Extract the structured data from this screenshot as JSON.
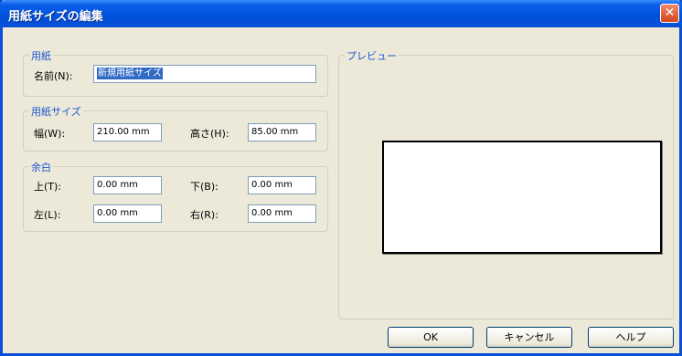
{
  "window": {
    "title": "用紙サイズの編集",
    "close_glyph": "✕"
  },
  "paper": {
    "legend": "用紙",
    "name_label": "名前(N):",
    "name_value": "新規用紙サイズ"
  },
  "size": {
    "legend": "用紙サイズ",
    "width_label": "幅(W):",
    "width_value": "210.00 mm",
    "height_label": "高さ(H):",
    "height_value": "85.00 mm"
  },
  "margin": {
    "legend": "余白",
    "top_label": "上(T):",
    "top_value": "0.00 mm",
    "bottom_label": "下(B):",
    "bottom_value": "0.00 mm",
    "left_label": "左(L):",
    "left_value": "0.00 mm",
    "right_label": "右(R):",
    "right_value": "0.00 mm"
  },
  "preview": {
    "legend": "プレビュー"
  },
  "buttons": {
    "ok": "OK",
    "cancel": "キャンセル",
    "help": "ヘルプ"
  }
}
